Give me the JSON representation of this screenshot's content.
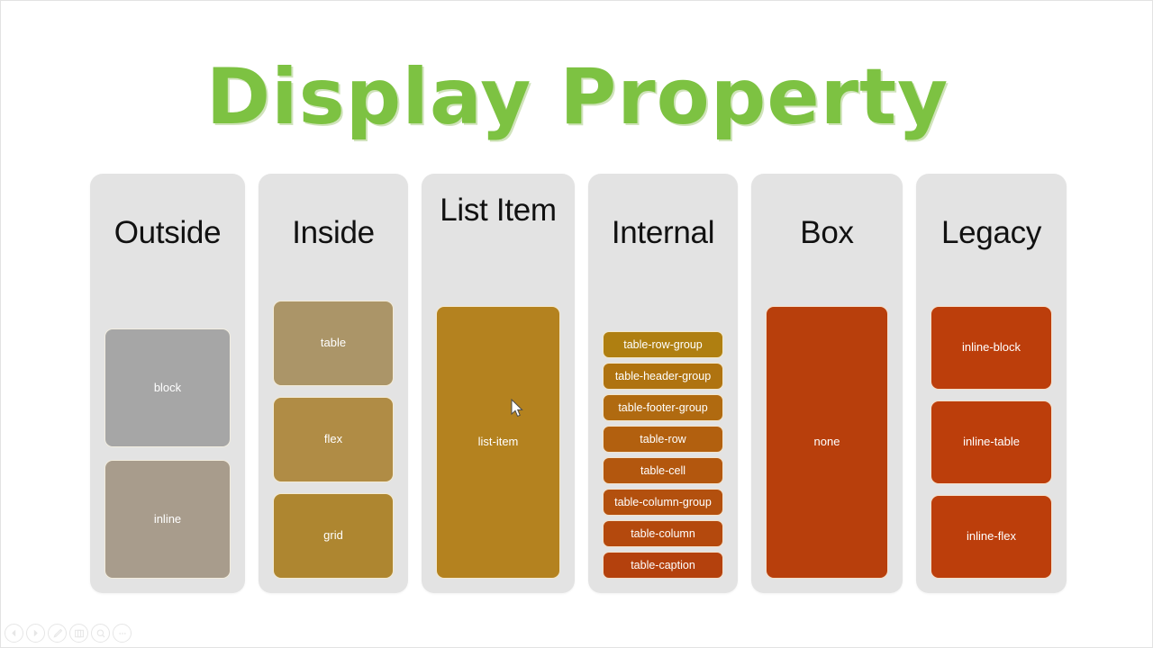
{
  "slide": {
    "title": "Display Property",
    "title_color": "#7DC242",
    "panel_bg": "#E3E3E3"
  },
  "columns": [
    {
      "header": "Outside",
      "name": "outside",
      "items": [
        {
          "label": "block",
          "color": "#A6A6A6"
        },
        {
          "label": "inline",
          "color": "#A89C8C"
        }
      ]
    },
    {
      "header": "Inside",
      "name": "inside",
      "items": [
        {
          "label": "table",
          "color": "#AB9568"
        },
        {
          "label": "flex",
          "color": "#B08C45"
        },
        {
          "label": "grid",
          "color": "#AE8630"
        }
      ]
    },
    {
      "header": "List Item",
      "name": "list-item",
      "items": [
        {
          "label": "list-item",
          "color": "#B4821F"
        }
      ]
    },
    {
      "header": "Internal",
      "name": "internal",
      "items": [
        {
          "label": "table-row-group",
          "color": "#AF7F11"
        },
        {
          "label": "table-header-group",
          "color": "#AF7310"
        },
        {
          "label": "table-footer-group",
          "color": "#B06A10"
        },
        {
          "label": "table-row",
          "color": "#B2600F"
        },
        {
          "label": "table-cell",
          "color": "#B3570E"
        },
        {
          "label": "table-column-group",
          "color": "#B3500E"
        },
        {
          "label": "table-column",
          "color": "#B4490D"
        },
        {
          "label": "table-caption",
          "color": "#B4410D"
        }
      ]
    },
    {
      "header": "Box",
      "name": "box",
      "items": [
        {
          "label": "none",
          "color": "#B83F0C"
        }
      ]
    },
    {
      "header": "Legacy",
      "name": "legacy",
      "items": [
        {
          "label": "inline-block",
          "color": "#BC3E0B"
        },
        {
          "label": "inline-table",
          "color": "#BC3E0B"
        },
        {
          "label": "inline-flex",
          "color": "#BC3E0B"
        }
      ]
    }
  ],
  "controls": [
    {
      "name": "previous-slide-button",
      "icon": "chevron-left-icon"
    },
    {
      "name": "next-slide-button",
      "icon": "play-icon"
    },
    {
      "name": "pen-tool-button",
      "icon": "pen-icon"
    },
    {
      "name": "all-slides-button",
      "icon": "grid-icon"
    },
    {
      "name": "zoom-button",
      "icon": "magnifier-icon"
    },
    {
      "name": "more-options-button",
      "icon": "ellipsis-icon"
    }
  ]
}
